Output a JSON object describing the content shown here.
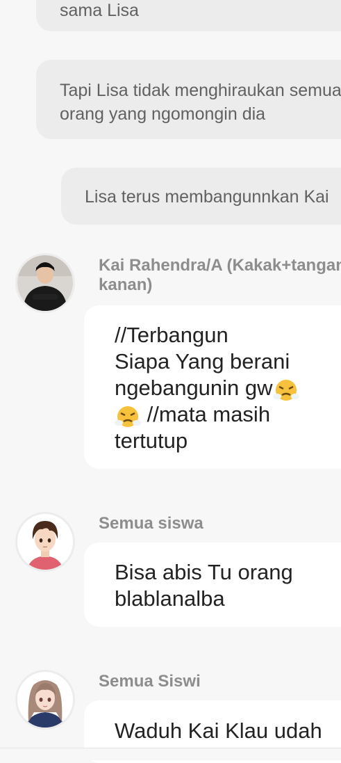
{
  "narration": [
    "sama Lisa",
    [
      "Tapi Lisa tidak menghiraukan semua",
      "orang yang ngomongin dia"
    ],
    "Lisa terus membangunnkan Kai"
  ],
  "messages": [
    {
      "sender_line1": "Kai Rahendra/A (Kakak+tangan",
      "sender_line2": "kanan)",
      "lines": [
        "//Terbangun",
        "Siapa Yang berani",
        "ngebangunin gw",
        " //mata masih",
        "tertutup"
      ],
      "avatar": "man-dark-shirt-avatar"
    },
    {
      "sender_line1": "Semua siswa",
      "lines": [
        "Bisa abis Tu orang",
        "blablanalba"
      ],
      "avatar": "anime-boy-avatar"
    },
    {
      "sender_line1": "Semua Siswi",
      "lines": [
        "Waduh Kai Klau udah"
      ],
      "avatar": "anime-girl-avatar"
    }
  ],
  "emoji": "angry-steam-face-emoji",
  "colors": {
    "narration_bg": "#ececec",
    "bubble_bg": "#ffffff",
    "page_bg": "#f7f7f7",
    "sender": "#8d8d8d"
  }
}
